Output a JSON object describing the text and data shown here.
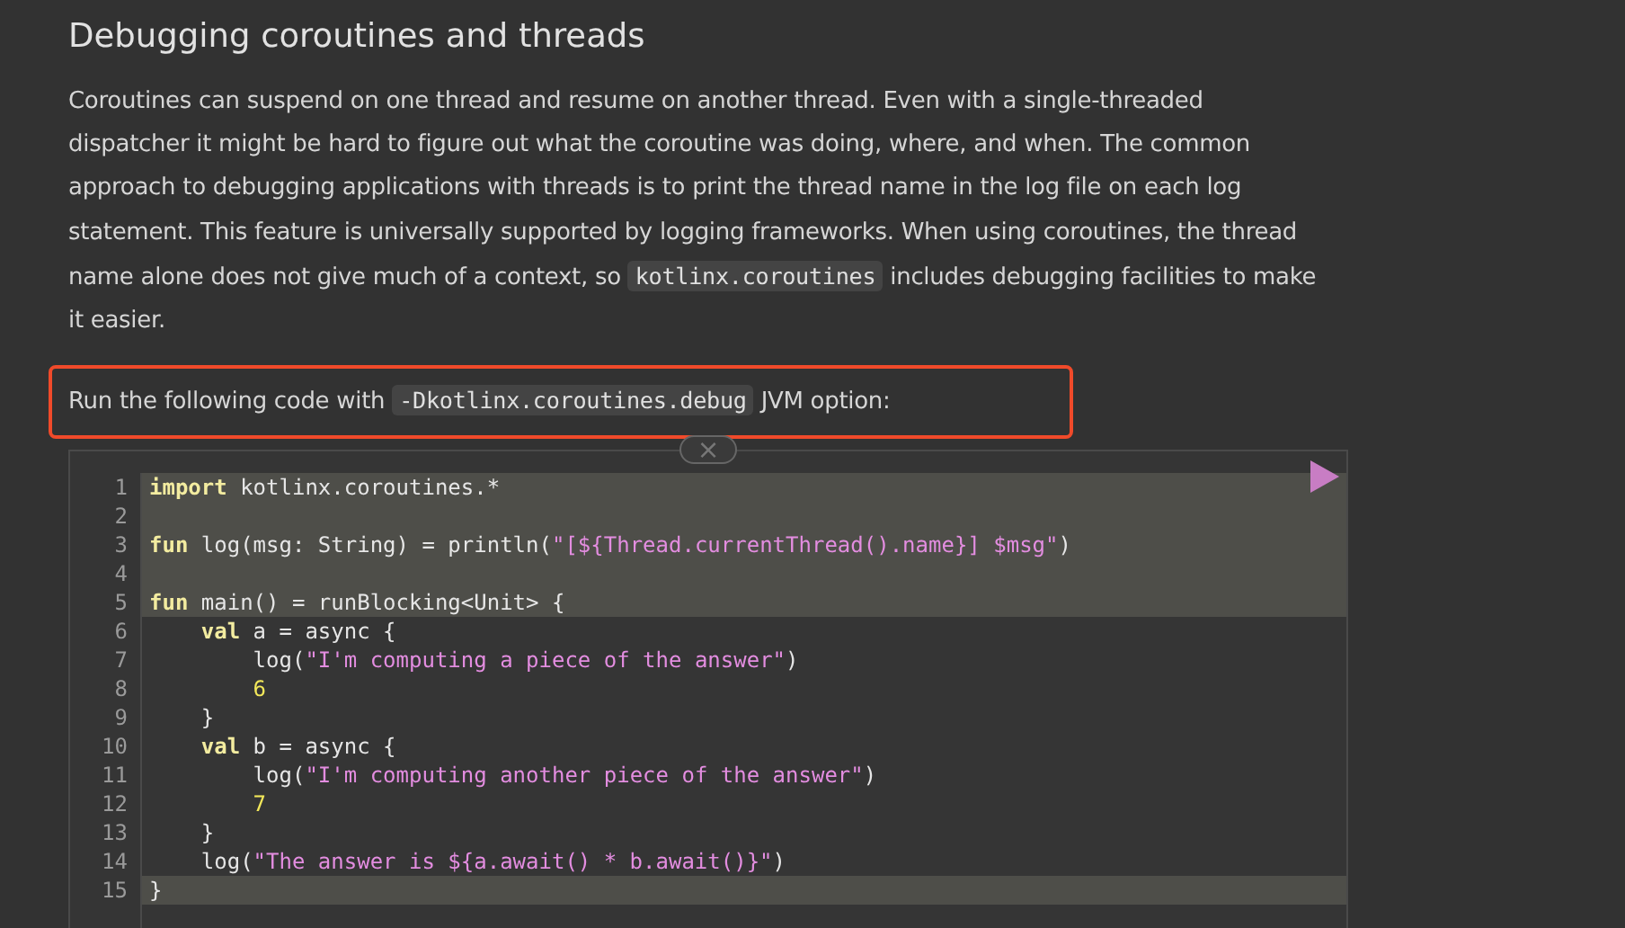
{
  "heading": "Debugging coroutines and threads",
  "paragraphs": [
    {
      "highlighted": false,
      "segments": [
        {
          "kind": "text",
          "text": "Coroutines can suspend on one thread and resume on another thread. Even with a single-threaded dispatcher it might be hard to figure out what the coroutine was doing, where, and when. The common approach to debugging applications with threads is to print the thread name in the log file on each log statement. This feature is universally supported by logging frameworks. When using coroutines, the thread name alone does not give much of a context, so "
        },
        {
          "kind": "code",
          "text": "kotlinx.coroutines"
        },
        {
          "kind": "text",
          "text": " includes debugging facilities to make it easier."
        }
      ]
    },
    {
      "highlighted": true,
      "segments": [
        {
          "kind": "text",
          "text": "Run the following code with "
        },
        {
          "kind": "code",
          "text": "-Dkotlinx.coroutines.debug"
        },
        {
          "kind": "text",
          "text": " JVM option:"
        }
      ]
    }
  ],
  "code_block": {
    "close_label": "×",
    "lines": [
      {
        "number": "1",
        "highlighted": true,
        "tokens": [
          {
            "kind": "keyword",
            "text": "import"
          },
          {
            "kind": "plain",
            "text": " kotlinx.coroutines.*"
          }
        ]
      },
      {
        "number": "2",
        "highlighted": true
      },
      {
        "number": "3",
        "highlighted": true,
        "tokens": [
          {
            "kind": "keyword",
            "text": "fun"
          },
          {
            "kind": "plain",
            "text": " log(msg: String) = println("
          },
          {
            "kind": "string",
            "text": "\"[${Thread.currentThread().name}] $msg\""
          },
          {
            "kind": "plain",
            "text": ")"
          }
        ]
      },
      {
        "number": "4",
        "highlighted": true
      },
      {
        "number": "5",
        "highlighted": true,
        "tokens": [
          {
            "kind": "keyword",
            "text": "fun"
          },
          {
            "kind": "plain",
            "text": " main() = runBlocking<Unit> {"
          }
        ]
      },
      {
        "number": "6",
        "highlighted": false,
        "tokens": [
          {
            "kind": "keyword",
            "text": "    val"
          },
          {
            "kind": "plain",
            "text": " a = async {"
          }
        ]
      },
      {
        "number": "7",
        "highlighted": false,
        "tokens": [
          {
            "kind": "plain",
            "text": "        log("
          },
          {
            "kind": "string",
            "text": "\"I'm computing a piece of the answer\""
          },
          {
            "kind": "plain",
            "text": ")"
          }
        ]
      },
      {
        "number": "8",
        "highlighted": false,
        "tokens": [
          {
            "kind": "number",
            "text": "        6"
          }
        ]
      },
      {
        "number": "9",
        "highlighted": false,
        "tokens": [
          {
            "kind": "plain",
            "text": "    }"
          }
        ]
      },
      {
        "number": "10",
        "highlighted": false,
        "tokens": [
          {
            "kind": "keyword",
            "text": "    val"
          },
          {
            "kind": "plain",
            "text": " b = async {"
          }
        ]
      },
      {
        "number": "11",
        "highlighted": false,
        "tokens": [
          {
            "kind": "plain",
            "text": "        log("
          },
          {
            "kind": "string",
            "text": "\"I'm computing another piece of the answer\""
          },
          {
            "kind": "plain",
            "text": ")"
          }
        ]
      },
      {
        "number": "12",
        "highlighted": false,
        "tokens": [
          {
            "kind": "number",
            "text": "        7"
          }
        ]
      },
      {
        "number": "13",
        "highlighted": false,
        "tokens": [
          {
            "kind": "plain",
            "text": "    }"
          }
        ]
      },
      {
        "number": "14",
        "highlighted": false,
        "tokens": [
          {
            "kind": "plain",
            "text": "    log("
          },
          {
            "kind": "string",
            "text": "\"The answer is ${a.await() * b.await()}\""
          },
          {
            "kind": "plain",
            "text": ")"
          }
        ]
      },
      {
        "number": "15",
        "highlighted": true,
        "tokens": [
          {
            "kind": "plain",
            "text": "}"
          }
        ]
      }
    ]
  }
}
